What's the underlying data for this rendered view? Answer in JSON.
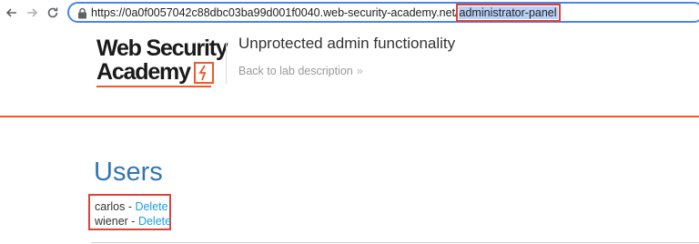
{
  "browser": {
    "url_prefix": "https://0a0f0057042c88dbc03ba99d001f0040.web-security-academy.net/",
    "url_highlight": "administrator-panel"
  },
  "header": {
    "logo_line1": "Web Security",
    "logo_line2": "Academy",
    "lab_title": "Unprotected admin functionality",
    "back_link": "Back to lab description",
    "back_chevron": "»"
  },
  "main": {
    "heading": "Users",
    "users": [
      {
        "name": "carlos",
        "separator": " - ",
        "action": "Delete"
      },
      {
        "name": "wiener",
        "separator": " - ",
        "action": "Delete"
      }
    ]
  },
  "colors": {
    "accent": "#f05a28",
    "link": "#1c9ee2",
    "heading": "#3276b1",
    "annotation": "#d9433b"
  }
}
